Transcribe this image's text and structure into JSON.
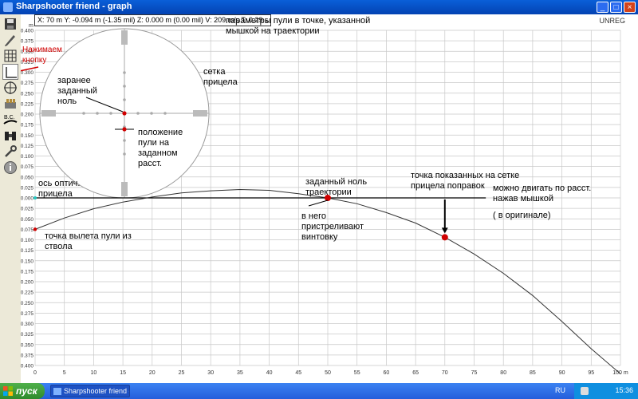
{
  "window": {
    "title": "Sharpshooter friend - graph"
  },
  "status_bar": {
    "text": "X: 70 m  Y: -0.094 m (-1.35 mil)  Z: 0.000 m (0.00 mil)  V: 209 m/s  T: 0.29 s"
  },
  "unreg": "UNREG",
  "toolbar": {
    "items": [
      {
        "name": "save",
        "icon": "floppy-icon"
      },
      {
        "name": "pencil",
        "icon": "pencil-icon"
      },
      {
        "name": "grid",
        "icon": "grid-icon"
      },
      {
        "name": "graph",
        "icon": "graph-icon",
        "active": true
      },
      {
        "name": "crosshair",
        "icon": "crosshair-icon"
      },
      {
        "name": "ammo",
        "icon": "ammo-icon"
      },
      {
        "name": "bc",
        "icon": "bc-icon",
        "label": "B.C."
      },
      {
        "name": "binoculars",
        "icon": "binoculars-icon"
      },
      {
        "name": "tools",
        "icon": "wrench-icon"
      },
      {
        "name": "info",
        "icon": "info-icon"
      }
    ]
  },
  "chart_data": {
    "type": "line",
    "xunit": "m",
    "yunit": "m",
    "xlim": [
      0,
      100
    ],
    "ylim": [
      0.4,
      -0.4
    ],
    "x_ticks": [
      0,
      5,
      10,
      15,
      20,
      25,
      30,
      35,
      40,
      45,
      50,
      55,
      60,
      65,
      70,
      75,
      80,
      85,
      90,
      95,
      100
    ],
    "y_ticks": [
      "0.400",
      "0.375",
      "0.350",
      "0.325",
      "0.300",
      "0.275",
      "0.250",
      "0.225",
      "0.200",
      "0.175",
      "0.150",
      "0.125",
      "0.100",
      "0.075",
      "0.050",
      "0.025",
      "0.000",
      "0.025",
      "0.050",
      "0.075",
      "0.100",
      "0.125",
      "0.150",
      "0.175",
      "0.200",
      "0.225",
      "0.250",
      "0.275",
      "0.300",
      "0.325",
      "0.350",
      "0.375",
      "0.400"
    ],
    "grid": true,
    "trajectory": {
      "x": [
        0,
        5,
        10,
        15,
        20,
        25,
        30,
        35,
        40,
        45,
        50,
        55,
        60,
        65,
        70,
        75,
        80,
        85,
        90,
        95,
        100
      ],
      "y": [
        -0.075,
        -0.048,
        -0.026,
        -0.01,
        0.002,
        0.012,
        0.017,
        0.02,
        0.018,
        0.01,
        0.0,
        -0.014,
        -0.035,
        -0.06,
        -0.094,
        -0.134,
        -0.18,
        -0.233,
        -0.295,
        -0.36,
        -0.42
      ]
    },
    "sight_axis_y": 0,
    "points": [
      {
        "name": "muzzle",
        "x": 0,
        "y": -0.075
      },
      {
        "name": "zero",
        "x": 50,
        "y": 0.0
      },
      {
        "name": "selected",
        "x": 70,
        "y": -0.094
      }
    ]
  },
  "annotations": {
    "pressed_button": "Нажимаем\nкнопку",
    "bullet_params": "параметры пули в точке, указанной\nмышкой на траектории",
    "reticle": "сетка\nприцела",
    "preset_zero": "заранее\nзаданный\nноль",
    "bullet_position": "положение\nпули на\nзаданном\nрасст.",
    "sight_axis": "ось оптич.\nприцела",
    "trajectory_zero": "заданный ноль\nтраектории",
    "zeroed_in": "в него\nпристреливают\nвинтовку",
    "muzzle_point": "точка вылета пули из\nствола",
    "correction_point": "точка показанных на сетке\nприцела поправок",
    "movable": "можно двигать по расст.\nнажав мышкой",
    "in_original": "( в оригинале)"
  },
  "taskbar": {
    "start_label": "пуск",
    "window_button": "Sharpshooter friend -...",
    "lang": "RU",
    "clock": "15:36"
  }
}
